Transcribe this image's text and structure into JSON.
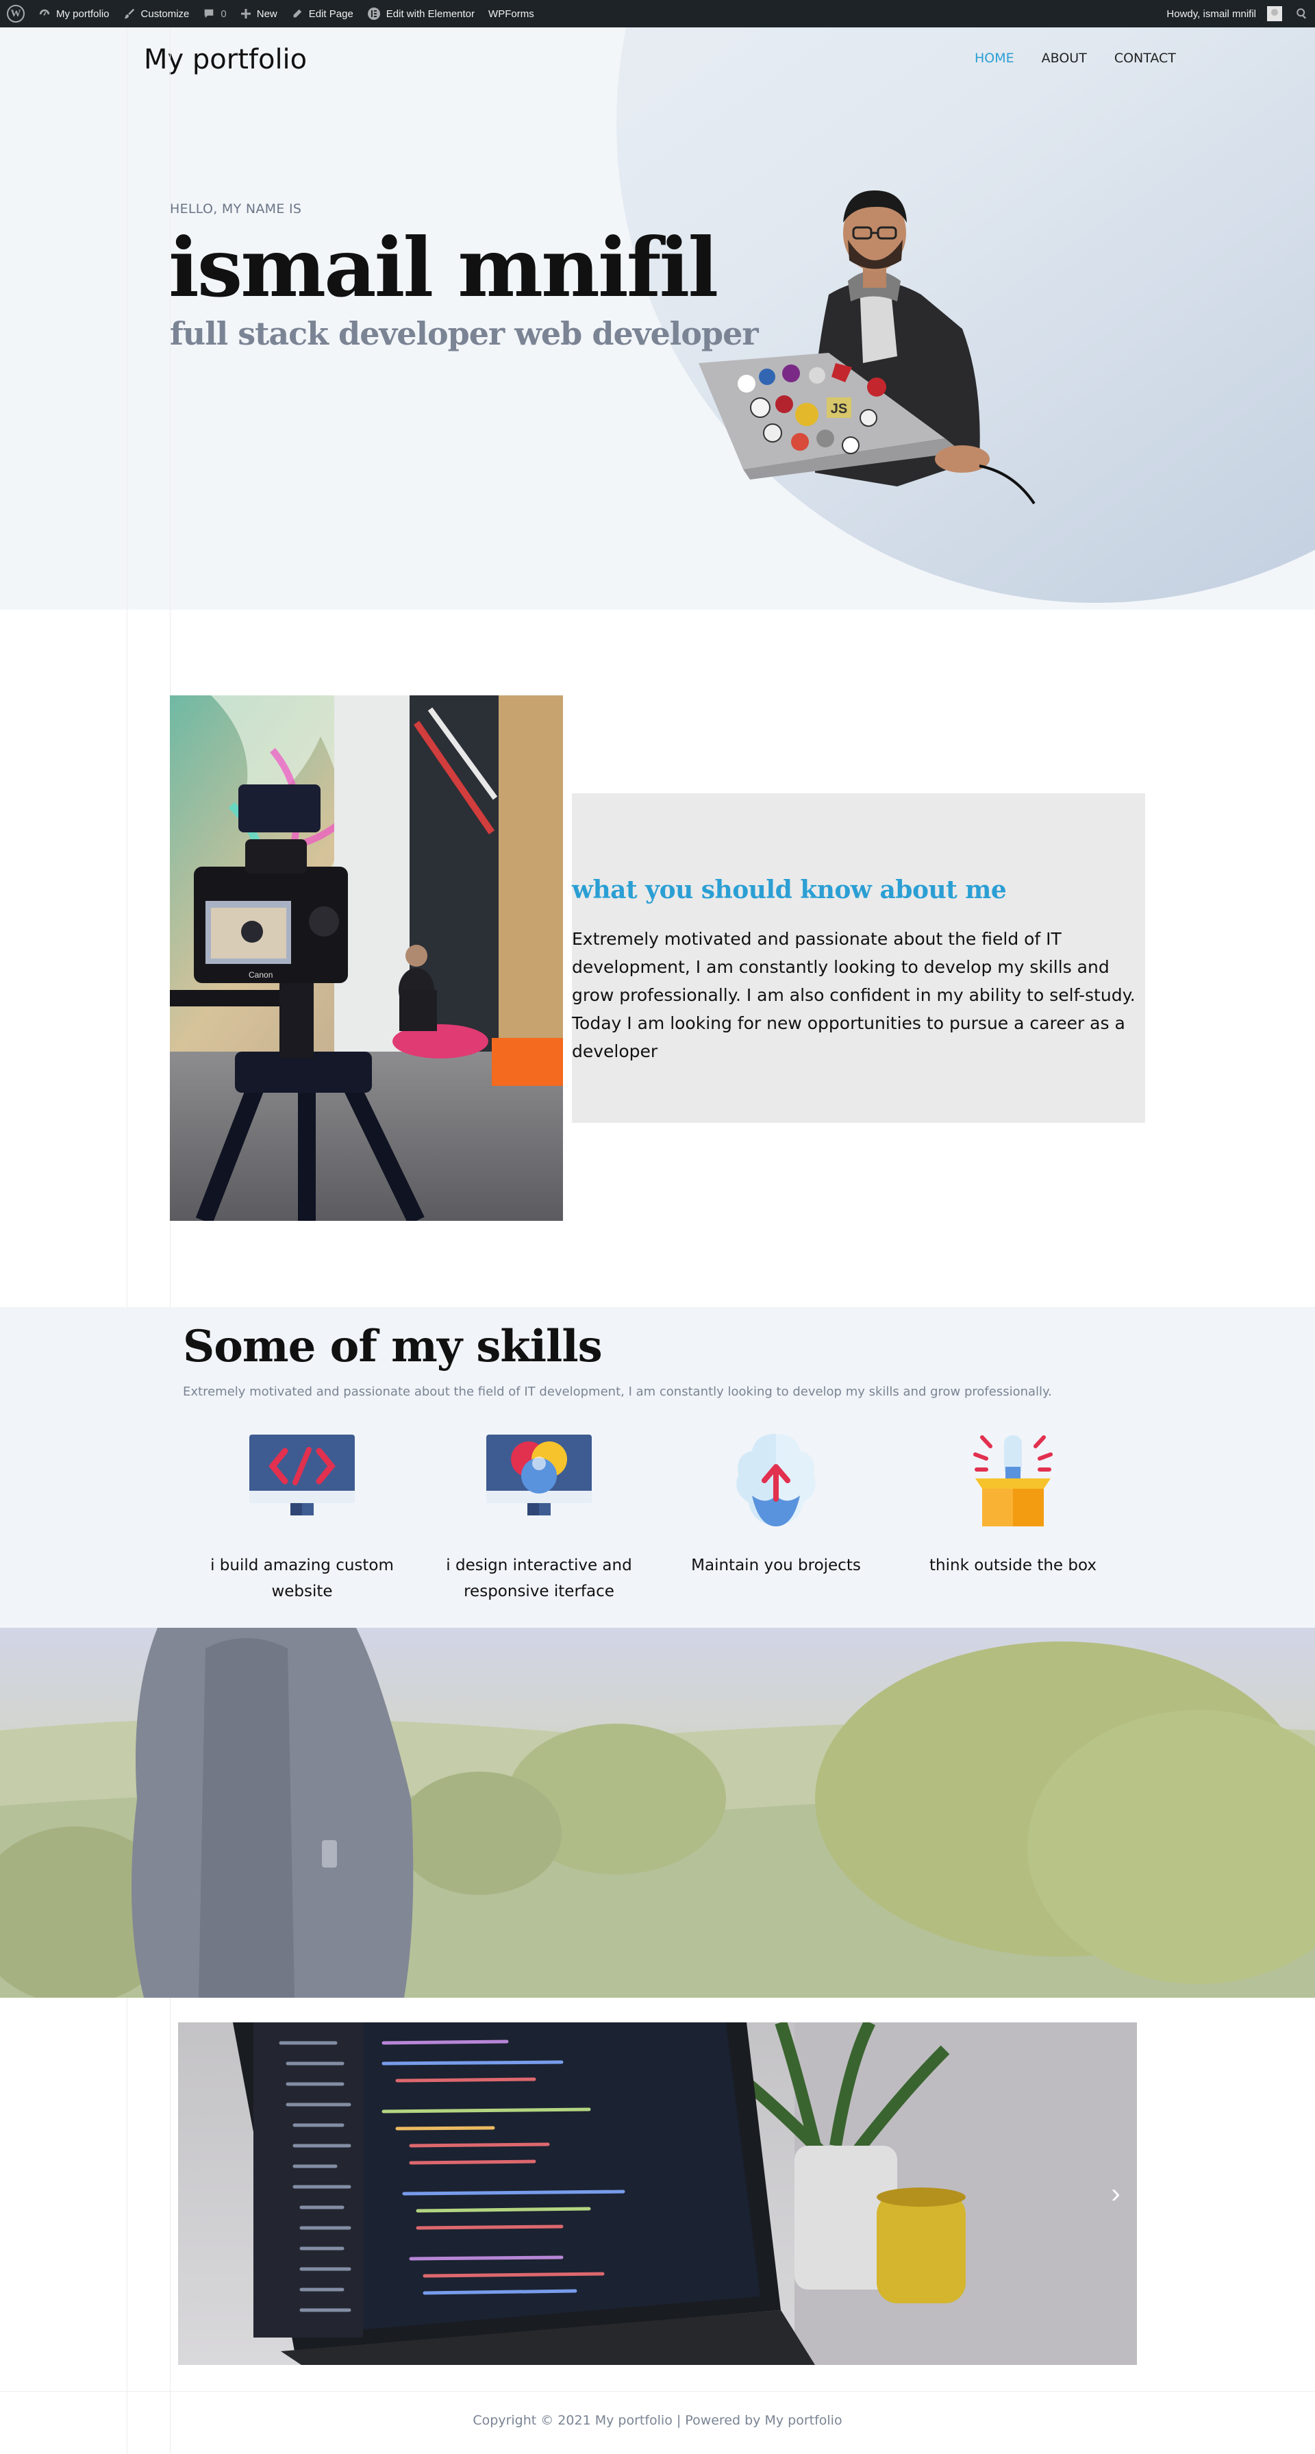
{
  "adminbar": {
    "site_name": "My portfolio",
    "customize": "Customize",
    "comments_count": "0",
    "new": "New",
    "edit_page": "Edit Page",
    "edit_elementor": "Edit with Elementor",
    "wpforms": "WPForms",
    "howdy": "Howdy, ismail mnifil"
  },
  "header": {
    "site_title": "My portfolio",
    "nav": [
      "HOME",
      "ABOUT",
      "CONTACT"
    ]
  },
  "hero": {
    "greeting": "HELLO, MY NAME IS",
    "name": "ismail mnifil",
    "role": "full stack developer web developer",
    "laptop_sticker": "JS"
  },
  "about": {
    "title": "what you should know about me",
    "text": "Extremely motivated and passionate about the field of IT development, I am constantly looking to develop my skills and grow professionally. I am also confident in my ability to self-study. Today I am looking for new opportunities to pursue a career as a developer",
    "camera_brand": "Canon"
  },
  "skills": {
    "title": "Some of my skills",
    "subtitle": "Extremely motivated and passionate about the field of IT development, I am constantly looking to develop my skills and grow professionally.",
    "items": [
      {
        "label": "i build amazing custom website",
        "icon": "code-monitor-icon"
      },
      {
        "label": "i design interactive and responsive iterface",
        "icon": "color-monitor-icon"
      },
      {
        "label": "Maintain you brojects",
        "icon": "brain-upload-icon"
      },
      {
        "label": "think outside the box",
        "icon": "idea-box-icon"
      }
    ]
  },
  "slider": {
    "next_glyph": "›"
  },
  "footer": {
    "text": "Copyright © 2021 My portfolio | Powered by My portfolio"
  },
  "colors": {
    "accent": "#2b9fd4",
    "admin_bar": "#1d2327",
    "hero_bg": "#f3f6f9",
    "muted": "#7a8494"
  }
}
